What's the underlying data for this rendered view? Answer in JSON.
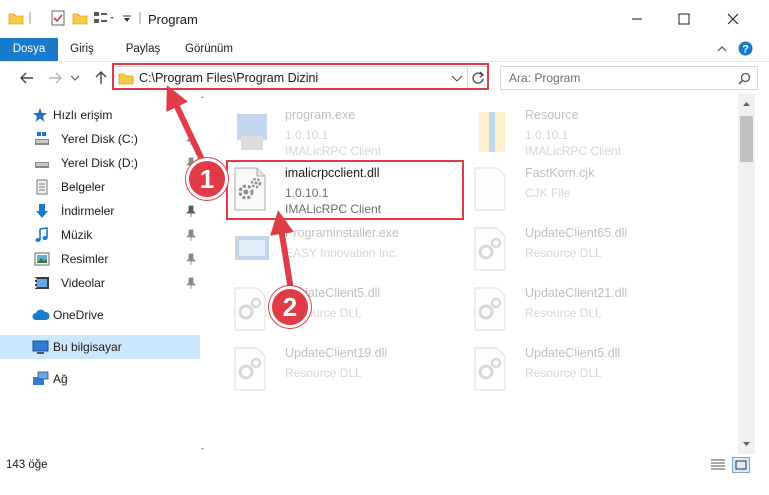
{
  "window": {
    "title": "Program"
  },
  "ribbon": {
    "tabs": [
      {
        "label": "Dosya",
        "active": true
      },
      {
        "label": "Giriş",
        "active": false
      },
      {
        "label": "Paylaş",
        "active": false
      },
      {
        "label": "Görünüm",
        "active": false
      }
    ]
  },
  "address": {
    "path": "C:\\Program Files\\Program Dizini"
  },
  "search": {
    "placeholder": "Ara: Program"
  },
  "sidebar": {
    "items": [
      {
        "label": "Hızlı erişim",
        "icon": "star-icon"
      },
      {
        "label": "Yerel Disk (C:)",
        "icon": "drive-icon"
      },
      {
        "label": "Yerel Disk (D:)",
        "icon": "drive-icon"
      },
      {
        "label": "Belgeler",
        "icon": "documents-icon"
      },
      {
        "label": "İndirmeler",
        "icon": "download-icon"
      },
      {
        "label": "Müzik",
        "icon": "music-icon"
      },
      {
        "label": "Resimler",
        "icon": "pictures-icon"
      },
      {
        "label": "Videolar",
        "icon": "videos-icon"
      },
      {
        "label": "OneDrive",
        "icon": "cloud-icon"
      },
      {
        "label": "Bu bilgisayar",
        "icon": "computer-icon"
      },
      {
        "label": "Ağ",
        "icon": "network-icon"
      }
    ]
  },
  "files": [
    {
      "name": "program.exe",
      "line1": "1.0.10.1",
      "line2": "IMALicRPC Client"
    },
    {
      "name": "Resource",
      "line1": "1.0.10.1",
      "line2": "IMALicRPC Client"
    },
    {
      "name": "imalicrpcclient.dll",
      "line1": "1.0.10.1",
      "line2": "IMALicRPC Client"
    },
    {
      "name": "FastKorn.cjk",
      "line1": "CJK File",
      "line2": ""
    },
    {
      "name": "Programinstaller.exe",
      "line1": "EASY Innovation Inc.",
      "line2": ""
    },
    {
      "name": "UpdateClient65.dll",
      "line1": "Resource DLL",
      "line2": ""
    },
    {
      "name": "UpdateClient5.dll",
      "line1": "Resource DLL",
      "line2": ""
    },
    {
      "name": "UpdateClient21.dll",
      "line1": "Resource DLL",
      "line2": ""
    },
    {
      "name": "UpdateClient19.dll",
      "line1": "Resource DLL",
      "line2": ""
    },
    {
      "name": "UpdateClient5.dll",
      "line1": "Resource DLL",
      "line2": ""
    }
  ],
  "status": {
    "count": "143 öğe"
  },
  "annotations": {
    "badge1": "1",
    "badge2": "2",
    "color": "#e03c48"
  },
  "colors": {
    "accent": "#1979ca",
    "selection": "#cce8ff"
  }
}
